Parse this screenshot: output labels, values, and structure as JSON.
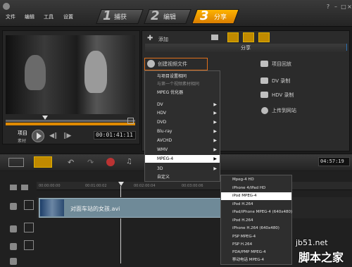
{
  "menu": [
    "文件",
    "编辑",
    "工具",
    "设置"
  ],
  "steps": [
    {
      "num": "1",
      "label": "捕获"
    },
    {
      "num": "2",
      "label": "编辑"
    },
    {
      "num": "3",
      "label": "分享"
    }
  ],
  "preview": {
    "project_label": "项目",
    "clip_label": "素材",
    "timecode": "00:01:41:11"
  },
  "library": {
    "add_label": "添加",
    "share_title": "分享",
    "options_left": [
      "创建视频文件"
    ],
    "options_right": [
      "项目回放",
      "DV 录制",
      "HDV 录制",
      "上传到网站"
    ]
  },
  "timeline": {
    "ruler_ticks": [
      "00:00:00:00",
      "00:01:00:02",
      "00:02:00:04",
      "00:03:00:06"
    ],
    "clip_name": "对面车站的女孩.avi",
    "timecode_right": "04:57:19"
  },
  "context_menu": {
    "items": [
      {
        "label": "与项目设置相同",
        "type": "normal"
      },
      {
        "label": "与第一个视频素材相同",
        "type": "disabled"
      },
      {
        "label": "MPEG 优化器",
        "type": "normal"
      },
      {
        "label": "DV",
        "type": "sub"
      },
      {
        "label": "HDV",
        "type": "sub"
      },
      {
        "label": "DVD",
        "type": "sub"
      },
      {
        "label": "Blu-ray",
        "type": "sub"
      },
      {
        "label": "AVCHD",
        "type": "sub"
      },
      {
        "label": "WMV",
        "type": "sub"
      },
      {
        "label": "MPEG-4",
        "type": "sub-hl"
      },
      {
        "label": "3D",
        "type": "sub"
      },
      {
        "label": "自定义",
        "type": "normal"
      }
    ]
  },
  "sub_menu": {
    "items": [
      "Mpeg-4 HD",
      "iPhone 4/iPad HD",
      "iPod MPEG-4",
      "iPod H.264",
      "iPad/iPhone MPEG-4 (640x480)",
      "iPod H.264",
      "iPhone H.264 (640x480)",
      "PSP MPEG-4",
      "PSP H.264",
      "PDA/PMP MPEG-4",
      "移动电话 MPEG-4"
    ],
    "highlight_index": 2
  },
  "watermark": {
    "line1": "jb51.net",
    "line2": "脚本之家"
  }
}
